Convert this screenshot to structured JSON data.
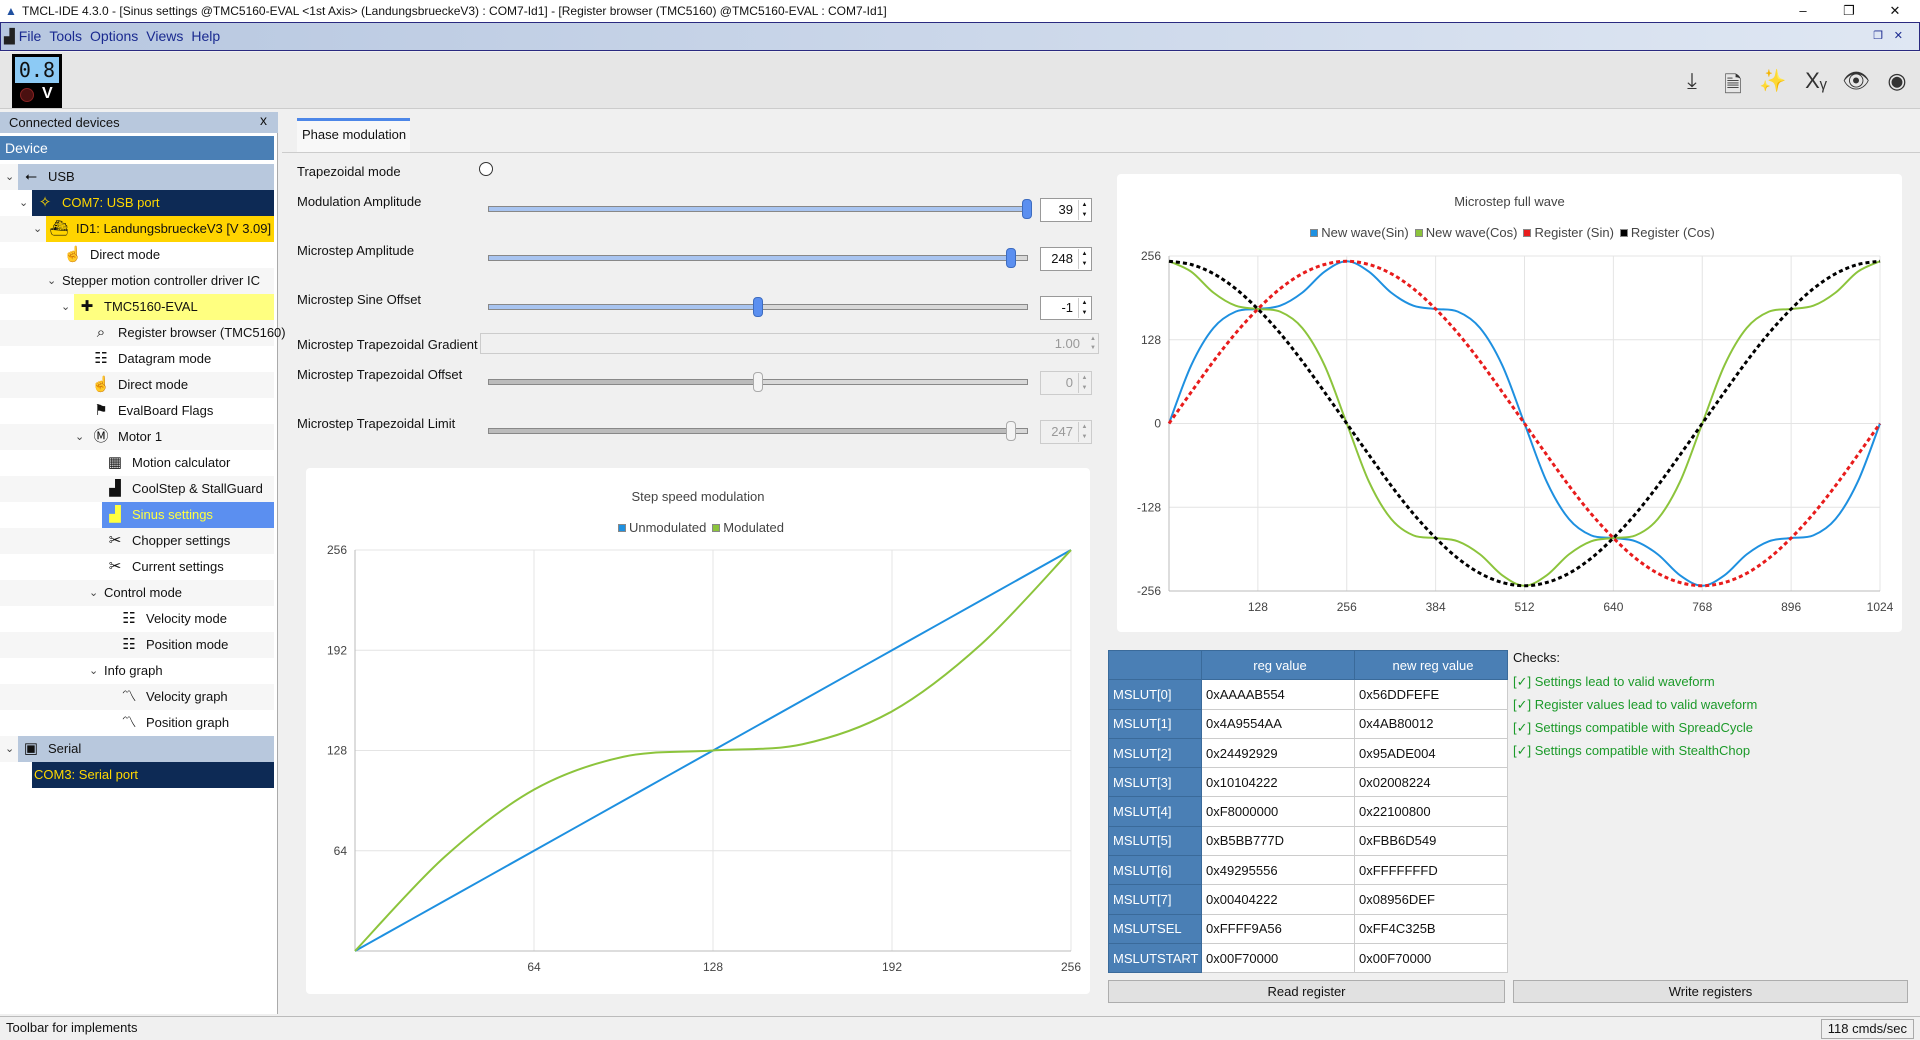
{
  "window": {
    "title": "TMCL-IDE 4.3.0 - [Sinus settings @TMC5160-EVAL <1st Axis> (LandungsbrueckeV3) : COM7-Id1] - [Register browser (TMC5160) @TMC5160-EVAL : COM7-Id1]",
    "minimize": "–",
    "restore": "❐",
    "close": "✕"
  },
  "menu": [
    "File",
    "Tools",
    "Options",
    "Views",
    "Help"
  ],
  "toolbar": {
    "voltage": "0.8",
    "unit": "V",
    "icons": [
      "download-icon",
      "export-document-icon",
      "wizard-icon",
      "x-of-y-icon",
      "eye-icon",
      "can-icon"
    ],
    "icon_glyphs": [
      "⤓",
      "🗎",
      "✨",
      "Xᵧ",
      "👁",
      "◉"
    ]
  },
  "sidebar": {
    "title": "Connected devices",
    "close": "x",
    "header": "Device",
    "items": [
      {
        "label": "USB",
        "level": 0,
        "chevron": true,
        "icon": "usb-icon",
        "glyph": "⭠",
        "style": "group"
      },
      {
        "label": "COM7: USB port",
        "level": 1,
        "chevron": true,
        "icon": "plug-icon",
        "glyph": "✧",
        "style": "port"
      },
      {
        "label": "ID1: LandungsbrueckeV3 [V 3.09]",
        "level": 2,
        "chevron": true,
        "icon": "ship-icon",
        "glyph": "⛴",
        "style": "board"
      },
      {
        "label": "Direct mode",
        "level": 3,
        "icon": "hand-icon",
        "glyph": "☝"
      },
      {
        "label": "Stepper motion controller driver IC",
        "level": 3,
        "chevron": true
      },
      {
        "label": "TMC5160-EVAL",
        "level": 4,
        "chevron": true,
        "icon": "puzzle-icon",
        "glyph": "✚",
        "style": "eval"
      },
      {
        "label": "Register browser (TMC5160)",
        "level": 5,
        "icon": "magnifier-icon",
        "glyph": "⌕"
      },
      {
        "label": "Datagram mode",
        "level": 5,
        "icon": "sliders-icon",
        "glyph": "☷"
      },
      {
        "label": "Direct mode",
        "level": 5,
        "icon": "hand-icon",
        "glyph": "☝"
      },
      {
        "label": "EvalBoard Flags",
        "level": 5,
        "icon": "flag-icon",
        "glyph": "⚑"
      },
      {
        "label": "Motor 1",
        "level": 5,
        "chevron": true,
        "icon": "motor-icon",
        "glyph": "Ⓜ"
      },
      {
        "label": "Motion calculator",
        "level": 6,
        "icon": "calculator-icon",
        "glyph": "▦"
      },
      {
        "label": "CoolStep & StallGuard",
        "level": 6,
        "icon": "bar-chart-icon",
        "glyph": "▟"
      },
      {
        "label": "Sinus settings",
        "level": 6,
        "icon": "bar-chart-icon",
        "glyph": "▟",
        "style": "selected"
      },
      {
        "label": "Chopper settings",
        "level": 6,
        "icon": "tools-icon",
        "glyph": "✂"
      },
      {
        "label": "Current settings",
        "level": 6,
        "icon": "tools-icon",
        "glyph": "✂"
      },
      {
        "label": "Control mode",
        "level": 6,
        "chevron": true
      },
      {
        "label": "Velocity mode",
        "level": 7,
        "icon": "sliders-icon",
        "glyph": "☷"
      },
      {
        "label": "Position mode",
        "level": 7,
        "icon": "sliders-icon",
        "glyph": "☷"
      },
      {
        "label": "Info graph",
        "level": 6,
        "chevron": true
      },
      {
        "label": "Velocity graph",
        "level": 7,
        "icon": "line-graph-icon",
        "glyph": "〽"
      },
      {
        "label": "Position graph",
        "level": 7,
        "icon": "line-graph-icon",
        "glyph": "〽"
      },
      {
        "label": "Serial",
        "level": 0,
        "chevron": true,
        "icon": "serial-icon",
        "glyph": "▣",
        "style": "group"
      },
      {
        "label": "COM3: Serial port",
        "level": 1,
        "style": "port"
      }
    ]
  },
  "tab": "Phase modulation",
  "form": {
    "trapezoidal_mode": {
      "label": "Trapezoidal mode",
      "checked": false
    },
    "sliders": [
      {
        "label": "Modulation Amplitude",
        "value": "39",
        "fraction": 1.0,
        "enabled": true
      },
      {
        "label": "Microstep Amplitude",
        "value": "248",
        "fraction": 0.97,
        "enabled": true
      },
      {
        "label": "Microstep Sine Offset",
        "value": "-1",
        "fraction": 0.5,
        "enabled": true
      },
      {
        "label": "Microstep Trapezoidal Offset",
        "value": "0",
        "fraction": 0.5,
        "enabled": false
      },
      {
        "label": "Microstep Trapezoidal Limit",
        "value": "247",
        "fraction": 0.97,
        "enabled": false
      }
    ],
    "gradient": {
      "label": "Microstep Trapezoidal Gradient",
      "value": "1.00"
    }
  },
  "chart_data": [
    {
      "type": "line",
      "title": "Step speed modulation",
      "xlim": [
        0,
        256
      ],
      "ylim": [
        0,
        256
      ],
      "xticks": [
        64,
        128,
        192,
        256
      ],
      "yticks": [
        64,
        128,
        192,
        256
      ],
      "grid": true,
      "legend": "top-center",
      "x": [
        0,
        32,
        64,
        96,
        128,
        160,
        192,
        224,
        256
      ],
      "series": [
        {
          "name": "Unmodulated",
          "color": "#1e90e0",
          "values": [
            0,
            32,
            64,
            96,
            128,
            160,
            192,
            224,
            256
          ]
        },
        {
          "name": "Modulated",
          "color": "#8cc43c",
          "values": [
            0,
            60,
            103,
            124,
            128,
            132,
            153,
            196,
            256
          ]
        }
      ]
    },
    {
      "type": "line",
      "title": "Microstep full wave",
      "xlim": [
        0,
        1024
      ],
      "ylim": [
        -256,
        256
      ],
      "xticks": [
        128,
        256,
        384,
        512,
        640,
        768,
        896,
        1024
      ],
      "yticks": [
        -256,
        -128,
        0,
        128,
        256
      ],
      "grid": true,
      "legend": "top-center",
      "x": [
        0,
        32,
        64,
        96,
        128,
        160,
        192,
        224,
        256,
        288,
        320,
        352,
        384,
        416,
        448,
        480,
        512,
        544,
        576,
        608,
        640,
        672,
        704,
        736,
        768,
        800,
        832,
        864,
        896,
        928,
        960,
        992,
        1024
      ],
      "series": [
        {
          "name": "New wave(Sin)",
          "color": "#1e90e0",
          "dashed": false,
          "values": [
            0,
            89,
            146,
            171,
            175,
            180,
            200,
            232,
            248,
            232,
            200,
            180,
            175,
            171,
            146,
            89,
            0,
            -89,
            -146,
            -171,
            -175,
            -180,
            -200,
            -232,
            -248,
            -232,
            -200,
            -180,
            -175,
            -171,
            -146,
            -89,
            0
          ]
        },
        {
          "name": "New wave(Cos)",
          "color": "#8cc43c",
          "dashed": false,
          "values": [
            248,
            232,
            200,
            180,
            175,
            171,
            146,
            89,
            0,
            -89,
            -146,
            -171,
            -175,
            -180,
            -200,
            -232,
            -248,
            -232,
            -200,
            -180,
            -175,
            -171,
            -146,
            -89,
            0,
            89,
            146,
            171,
            175,
            180,
            200,
            232,
            248
          ]
        },
        {
          "name": "Register (Sin)",
          "color": "#e81c1c",
          "dashed": true,
          "values": [
            0,
            48,
            95,
            138,
            175,
            206,
            229,
            243,
            248,
            243,
            229,
            206,
            175,
            138,
            95,
            48,
            0,
            -48,
            -95,
            -138,
            -175,
            -206,
            -229,
            -243,
            -248,
            -243,
            -229,
            -206,
            -175,
            -138,
            -95,
            -48,
            0
          ]
        },
        {
          "name": "Register (Cos)",
          "color": "#000000",
          "dashed": true,
          "values": [
            248,
            243,
            229,
            206,
            175,
            138,
            95,
            48,
            0,
            -48,
            -95,
            -138,
            -175,
            -206,
            -229,
            -243,
            -248,
            -243,
            -229,
            -206,
            -175,
            -138,
            -95,
            -48,
            0,
            48,
            95,
            138,
            175,
            206,
            229,
            243,
            248
          ]
        }
      ]
    }
  ],
  "registers": {
    "headers": [
      "",
      "reg value",
      "new reg value"
    ],
    "rows": [
      [
        "MSLUT[0]",
        "0xAAAAB554",
        "0x56DDFEFE"
      ],
      [
        "MSLUT[1]",
        "0x4A9554AA",
        "0x4AB80012"
      ],
      [
        "MSLUT[2]",
        "0x24492929",
        "0x95ADE004"
      ],
      [
        "MSLUT[3]",
        "0x10104222",
        "0x02008224"
      ],
      [
        "MSLUT[4]",
        "0xF8000000",
        "0x22100800"
      ],
      [
        "MSLUT[5]",
        "0xB5BB777D",
        "0xFBB6D549"
      ],
      [
        "MSLUT[6]",
        "0x49295556",
        "0xFFFFFFFD"
      ],
      [
        "MSLUT[7]",
        "0x00404222",
        "0x08956DEF"
      ],
      [
        "MSLUTSEL",
        "0xFFFF9A56",
        "0xFF4C325B"
      ],
      [
        "MSLUTSTART",
        "0x00F70000",
        "0x00F70000"
      ]
    ]
  },
  "checks": {
    "title": "Checks:",
    "items": [
      "[✓] Settings lead to valid waveform",
      "[✓] Register values lead to valid waveform",
      "[✓] Settings compatible with SpreadCycle",
      "[✓] Settings compatible with StealthChop"
    ]
  },
  "buttons": {
    "read": "Read register",
    "write": "Write registers"
  },
  "status": {
    "left": "Toolbar for implements",
    "right": "118 cmds/sec"
  }
}
